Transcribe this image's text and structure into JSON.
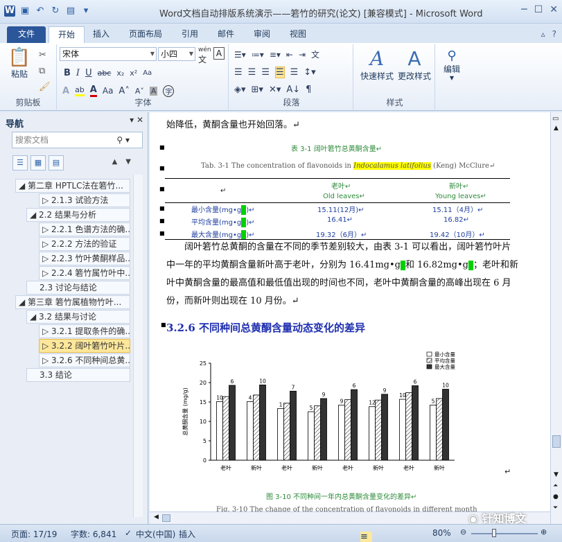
{
  "window": {
    "title": "Word文档自动排版系统演示——箬竹的研究(论文) [兼容模式] - Microsoft Word"
  },
  "ribbon_tabs": [
    "文件",
    "开始",
    "插入",
    "页面布局",
    "引用",
    "邮件",
    "审阅",
    "视图"
  ],
  "ribbon": {
    "clipboard": {
      "paste": "粘贴",
      "group": "剪贴板"
    },
    "font": {
      "name": "宋体",
      "size": "小四",
      "group": "字体",
      "wen": "wén"
    },
    "paragraph": {
      "group": "段落"
    },
    "styles": {
      "quick": "快速样式",
      "change": "更改样式",
      "group": "样式"
    },
    "edit": {
      "label": "编辑"
    }
  },
  "nav": {
    "title": "导航",
    "search_placeholder": "搜索文档",
    "items": [
      {
        "label": "第二章 HPTLC法在箬竹...",
        "level": 0
      },
      {
        "label": "2.1.3 试验方法",
        "level": 2
      },
      {
        "label": "2.2 结果与分析",
        "level": 1
      },
      {
        "label": "2.2.1 色谱方法的确...",
        "level": 2
      },
      {
        "label": "2.2.2 方法的验证",
        "level": 2
      },
      {
        "label": "2.2.3 竹叶黄酮样品...",
        "level": 2
      },
      {
        "label": "2.2.4 箬竹属竹叶中...",
        "level": 2
      },
      {
        "label": "2.3 讨论与结论",
        "level": 1
      },
      {
        "label": "第三章 箬竹属植物竹叶...",
        "level": 0
      },
      {
        "label": "3.2 结果与讨论",
        "level": 1
      },
      {
        "label": "3.2.1 提取条件的确...",
        "level": 2
      },
      {
        "label": "3.2.2 阔叶箬竹叶片...",
        "level": 2,
        "selected": true
      },
      {
        "label": "3.2.6 不同种间总黄...",
        "level": 2
      },
      {
        "label": "3.3 结论",
        "level": 1
      }
    ]
  },
  "doc": {
    "line0": "始降低，黄酮含量也开始回落。↵",
    "table_cap_cn": "表 3-1  阔叶箬竹总黄酮含量↵",
    "table_cap_en_pre": "Tab. 3-1 The concentration of flavonoids in ",
    "table_cap_en_hl": "Indocalamus latifolius",
    "table_cap_en_post": " (Keng) McClure↵",
    "table": {
      "h_old_cn": "老叶↵",
      "h_old_en": "Old leaves↵",
      "h_new_cn": "新叶↵",
      "h_new_en": "Young leaves↵",
      "rows": [
        {
          "label": "最小含量(mg•g",
          "old": "15.11(12月)↵",
          "new": "15.11（4月）↵"
        },
        {
          "label": "平均含量(mg•g",
          "old": "16.41↵",
          "new": "16.82↵"
        },
        {
          "label": "最大含量(mg•g",
          "old": "19.32（6月）↵",
          "new": "19.42（10月）↵"
        }
      ]
    },
    "para1": "阔叶箬竹总黄酮的含量在不同的季节差别较大，由表 3-1 可以看出，阔叶箬竹叶片",
    "para2a": "中一年的平均黄酮含量新叶高于老叶，分别为 16.41mg•g",
    "para2b": "和 16.82mg•g",
    "para2c": "；老叶和新",
    "para3": "叶中黄酮含量的最高值和最低值出现的时间也不同，老叶中黄酮含量的高峰出现在 6 月",
    "para4": "份，而新叶则出现在 10 月份。↵",
    "heading": "3.2.6  不同种间总黄酮含量动态变化的差异",
    "fig_cap_cn": "图 3-10  不同种间一年内总黄酮含量变化的差异↵",
    "fig_cap_en": "Fig. 3-10 The change of the concentration of flavonoids in different month"
  },
  "chart_data": {
    "type": "bar",
    "categories": [
      "老叶",
      "新叶",
      "老叶",
      "新叶",
      "老叶",
      "新叶",
      "老叶",
      "新叶"
    ],
    "series": [
      {
        "name": "最小含量",
        "values": [
          15.1,
          15.1,
          13.3,
          12.5,
          14.2,
          13.8,
          15.7,
          14.2
        ],
        "labels": [
          "10",
          "4",
          "1",
          "5",
          "9",
          "12",
          "10",
          "5"
        ]
      },
      {
        "name": "平均含量",
        "values": [
          16.4,
          16.8,
          14.7,
          14.0,
          15.6,
          15.5,
          17.4,
          15.9
        ],
        "labels": [
          "",
          "",
          "",
          "",
          "",
          "",
          "",
          ""
        ]
      },
      {
        "name": "最大含量",
        "values": [
          19.3,
          19.4,
          17.8,
          15.9,
          18.2,
          17.0,
          19.2,
          18.3
        ],
        "labels": [
          "6",
          "10",
          "7",
          "9",
          "6",
          "9",
          "6",
          "10"
        ]
      }
    ],
    "ylabel": "总黄酮含量 (mg/g)",
    "ylim": [
      0,
      25
    ],
    "yticks": [
      "0",
      "5",
      "10",
      "15",
      "20",
      "25"
    ],
    "grid": false,
    "legend": "top-right"
  },
  "status": {
    "page": "页面: 17/19",
    "words": "字数: 6,841",
    "lang": "中文(中国)",
    "mode": "插入",
    "zoom": "80%"
  },
  "watermark": "针知博文"
}
